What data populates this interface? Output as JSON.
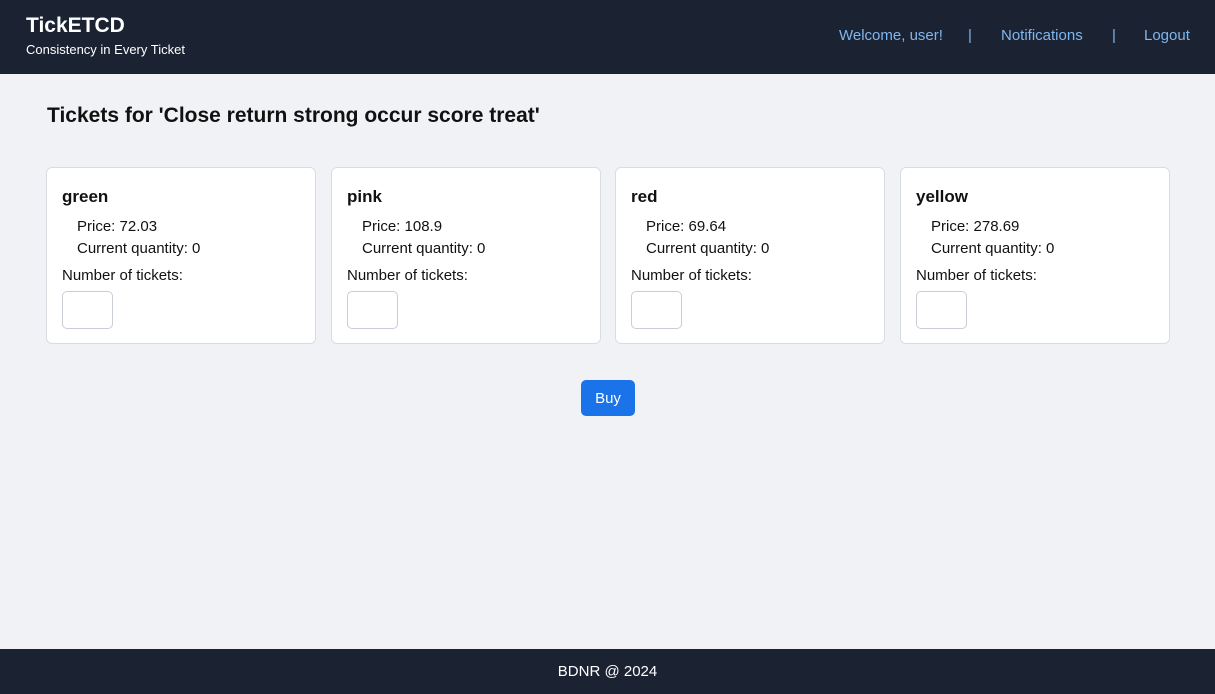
{
  "header": {
    "brand_title": "TickETCD",
    "brand_tagline": "Consistency in Every Ticket",
    "nav": {
      "welcome": "Welcome, user!",
      "separator": "|",
      "notifications": "Notifications",
      "logout": "Logout"
    }
  },
  "main": {
    "page_title": "Tickets for 'Close return strong occur score treat'",
    "tickets": [
      {
        "name": "green",
        "price_text": "Price: 72.03",
        "quantity_text": "Current quantity: 0",
        "input_label": "Number of tickets:",
        "input_value": ""
      },
      {
        "name": "pink",
        "price_text": "Price: 108.9",
        "quantity_text": "Current quantity: 0",
        "input_label": "Number of tickets:",
        "input_value": ""
      },
      {
        "name": "red",
        "price_text": "Price: 69.64",
        "quantity_text": "Current quantity: 0",
        "input_label": "Number of tickets:",
        "input_value": ""
      },
      {
        "name": "yellow",
        "price_text": "Price: 278.69",
        "quantity_text": "Current quantity: 0",
        "input_label": "Number of tickets:",
        "input_value": ""
      }
    ],
    "buy_label": "Buy"
  },
  "footer": {
    "text": "BDNR @ 2024"
  },
  "colors": {
    "header_bg": "#1b2333",
    "nav_link": "#7fb6ef",
    "page_bg": "#f0f2f5",
    "buy_button": "#1a73e8"
  }
}
